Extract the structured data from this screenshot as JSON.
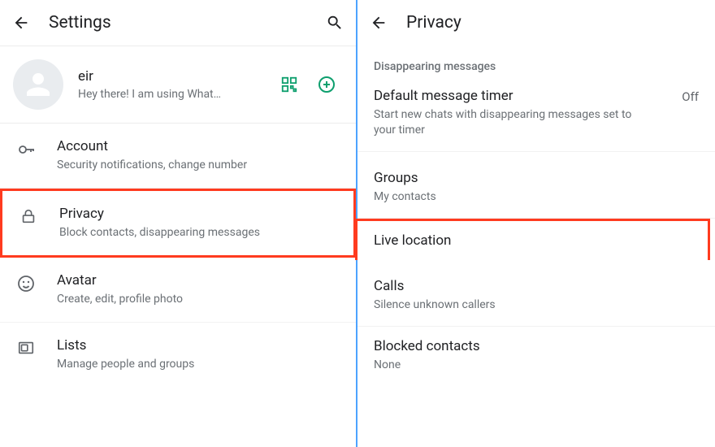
{
  "left": {
    "title": "Settings",
    "profile": {
      "name": "eir",
      "status": "Hey there! I am using What…"
    },
    "items": [
      {
        "title": "Account",
        "sub": "Security notifications, change number"
      },
      {
        "title": "Privacy",
        "sub": "Block contacts, disappearing messages"
      },
      {
        "title": "Avatar",
        "sub": "Create, edit, profile photo"
      },
      {
        "title": "Lists",
        "sub": "Manage people and groups"
      }
    ]
  },
  "right": {
    "title": "Privacy",
    "section_label": "Disappearing messages",
    "default_timer": {
      "title": "Default message timer",
      "sub": "Start new chats with disappearing messages set to your timer",
      "value": "Off"
    },
    "groups": {
      "title": "Groups",
      "sub": "My contacts"
    },
    "live_location": {
      "title": "Live location"
    },
    "calls": {
      "title": "Calls",
      "sub": "Silence unknown callers"
    },
    "blocked": {
      "title": "Blocked contacts",
      "sub": "None"
    }
  }
}
